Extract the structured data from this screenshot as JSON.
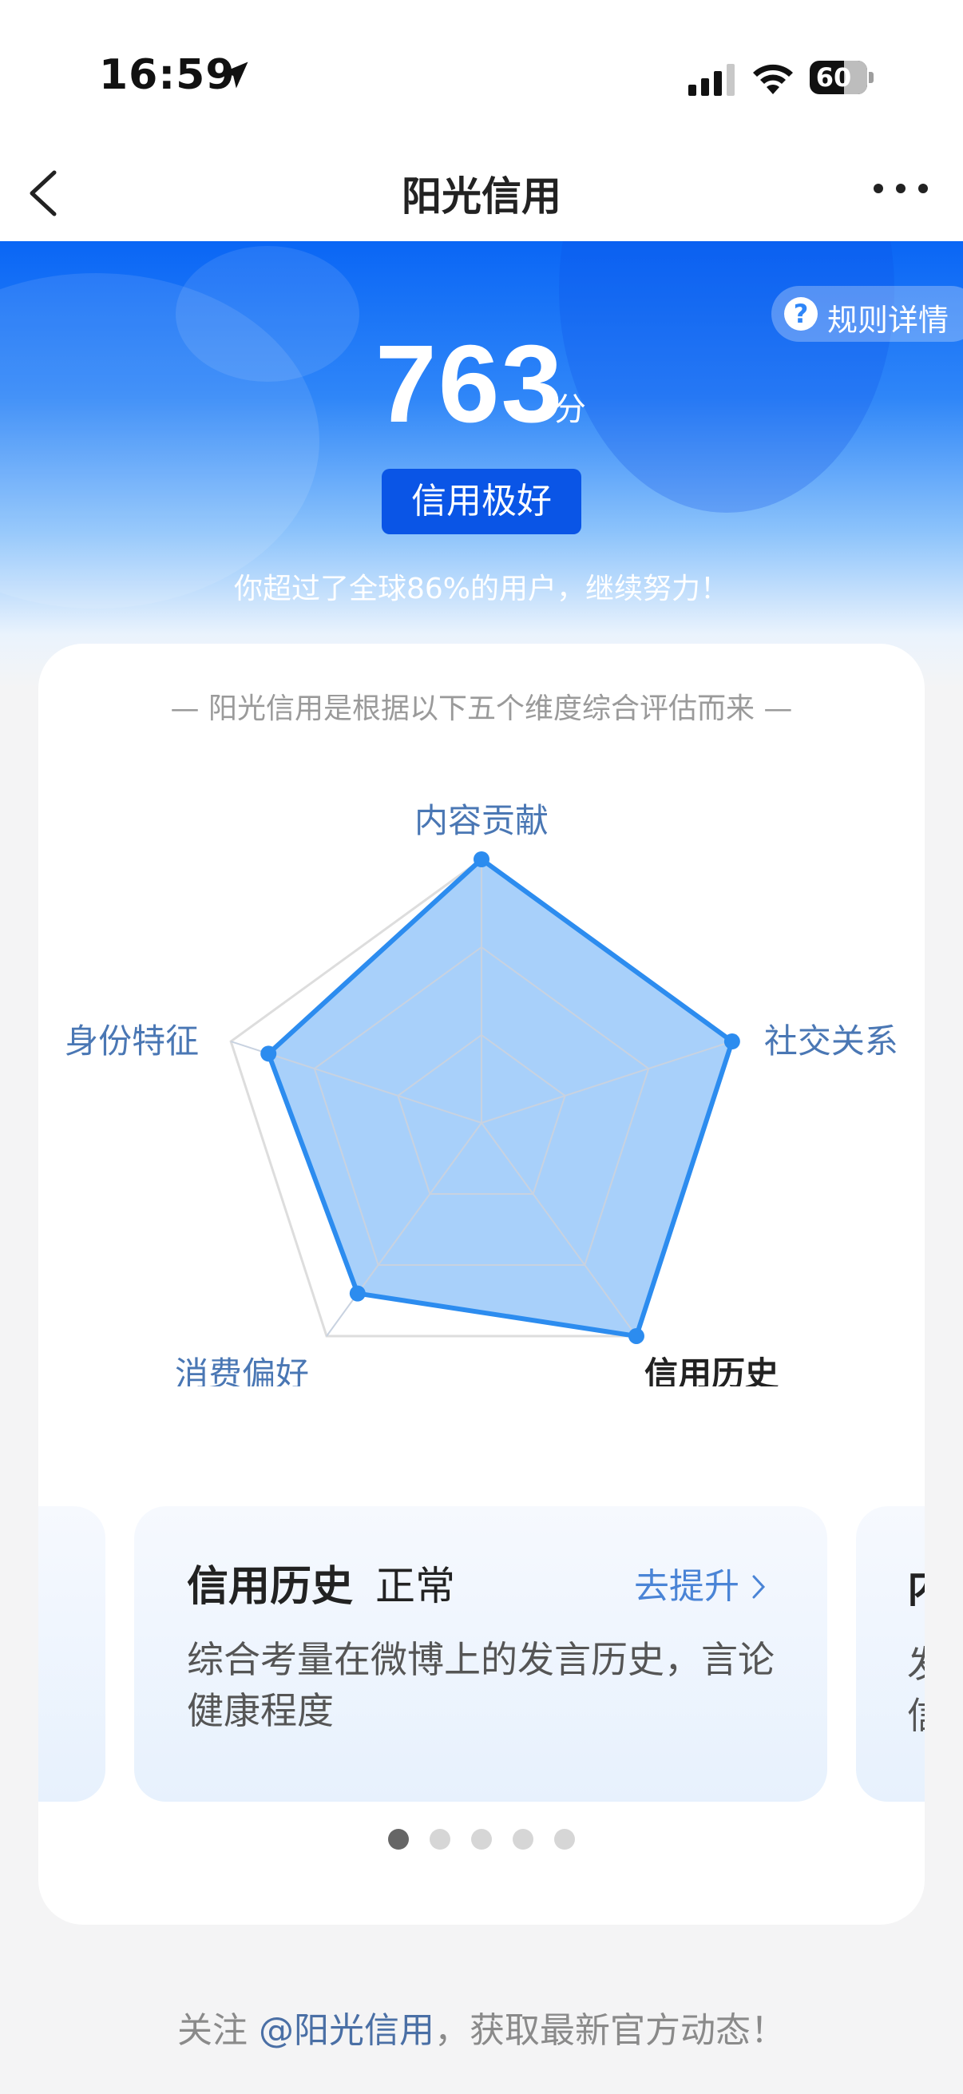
{
  "status_bar": {
    "time": "16:59",
    "battery": "60",
    "battery_level": 0.6
  },
  "nav": {
    "title": "阳光信用"
  },
  "hero": {
    "rules_label": "规则详情",
    "score": "763",
    "score_unit": "分",
    "badge": "信用极好",
    "percentile": "你超过了全球86%的用户，继续努力！"
  },
  "card": {
    "caption": "— 阳光信用是根据以下五个维度综合评估而来 —"
  },
  "chart_data": {
    "type": "radar",
    "axes": [
      "内容贡献",
      "社交关系",
      "信用历史",
      "消费偏好",
      "身份特征"
    ],
    "values": [
      1.0,
      1.0,
      1.0,
      0.8,
      0.85
    ],
    "max": 1,
    "active_axis": "信用历史",
    "colors": {
      "fill": "#9ecbf9",
      "stroke": "#2c8cef",
      "grid": "#c8d2e0",
      "outer": "#dddddd"
    }
  },
  "dimension": {
    "name": "信用历史",
    "status": "正常",
    "improve": "去提升",
    "description": "综合考量在微博上的发言历史，言论健康程度",
    "next_peek_title": "内",
    "next_peek_desc": "发\n信"
  },
  "pager": {
    "count": 5,
    "active": 0
  },
  "footer": {
    "prefix": "关注 ",
    "link": "@阳光信用",
    "suffix": "，获取最新官方动态！"
  }
}
